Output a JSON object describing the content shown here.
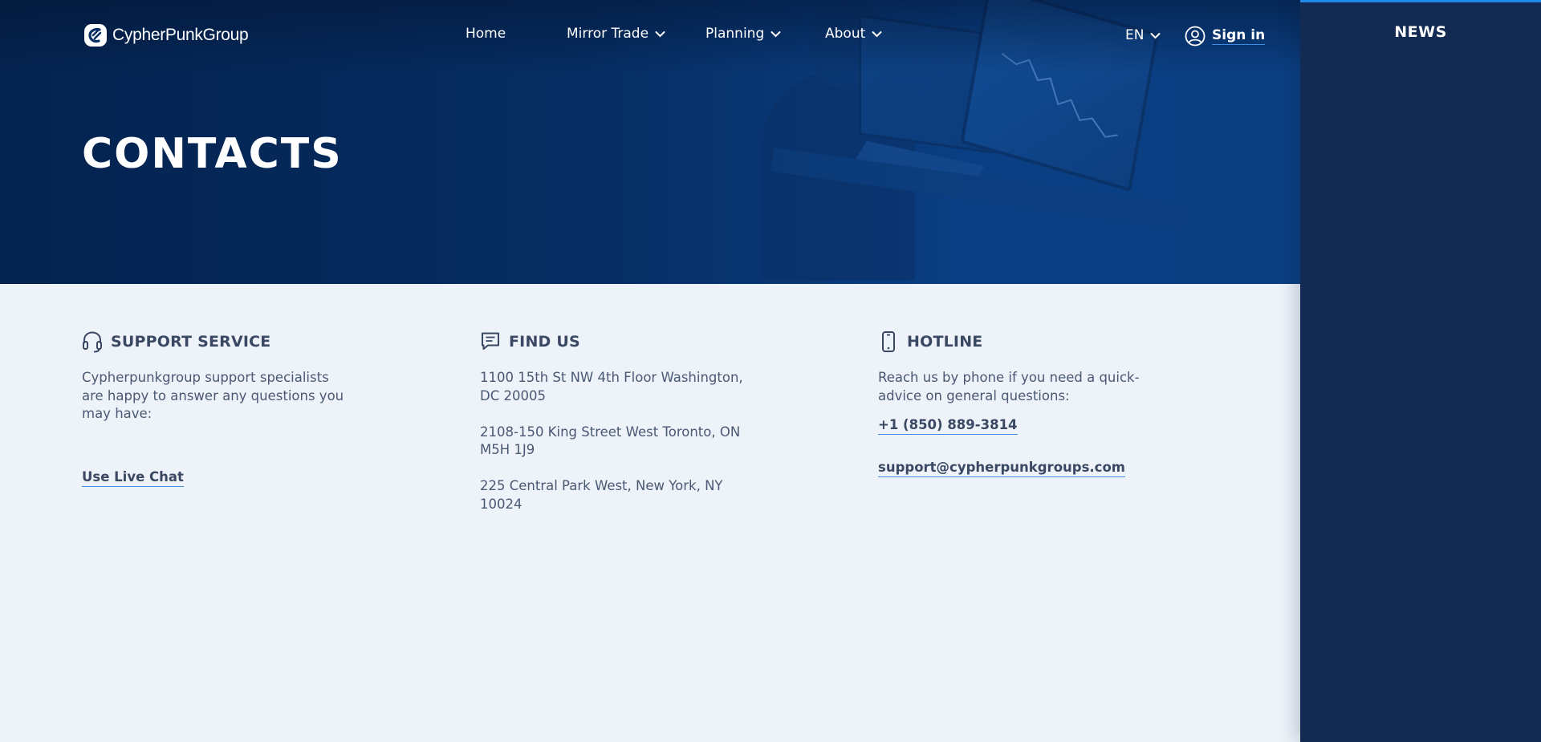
{
  "brand": {
    "name": "CypherPunkGroup",
    "logo_icon": "cypherpunk-logo"
  },
  "nav": {
    "items": [
      {
        "label": "Home",
        "has_dropdown": false
      },
      {
        "label": "Mirror Trade",
        "has_dropdown": true
      },
      {
        "label": "Planning",
        "has_dropdown": true
      },
      {
        "label": "About",
        "has_dropdown": true
      }
    ],
    "language": "EN",
    "sign_in": "Sign in"
  },
  "hero": {
    "title": "CONTACTS"
  },
  "support": {
    "title": "SUPPORT SERVICE",
    "icon": "headset-icon",
    "text": "Cypherpunkgroup support specialists are happy to answer any questions you may have:",
    "link": "Use Live Chat"
  },
  "find_us": {
    "title": "FIND US",
    "icon": "chat-icon",
    "addresses": [
      "1100 15th St NW 4th Floor Washington, DC 20005",
      "2108-150 King Street West Toronto, ON M5H 1J9",
      "225 Central Park West, New York, NY 10024"
    ]
  },
  "hotline": {
    "title": "HOTLINE",
    "icon": "phone-icon",
    "text": "Reach us by phone if you need a quick-advice on general questions:",
    "phone": "+1 (850) 889-3814",
    "email": "support@cypherpunkgroups.com"
  },
  "news": {
    "title": "NEWS"
  },
  "colors": {
    "hero_dark": "#04234f",
    "hero_light": "#0b3f82",
    "content_bg": "#eef3fa",
    "sidebar_bg": "#132a52",
    "accent": "#2188e6",
    "text_dark": "#3a4863"
  }
}
